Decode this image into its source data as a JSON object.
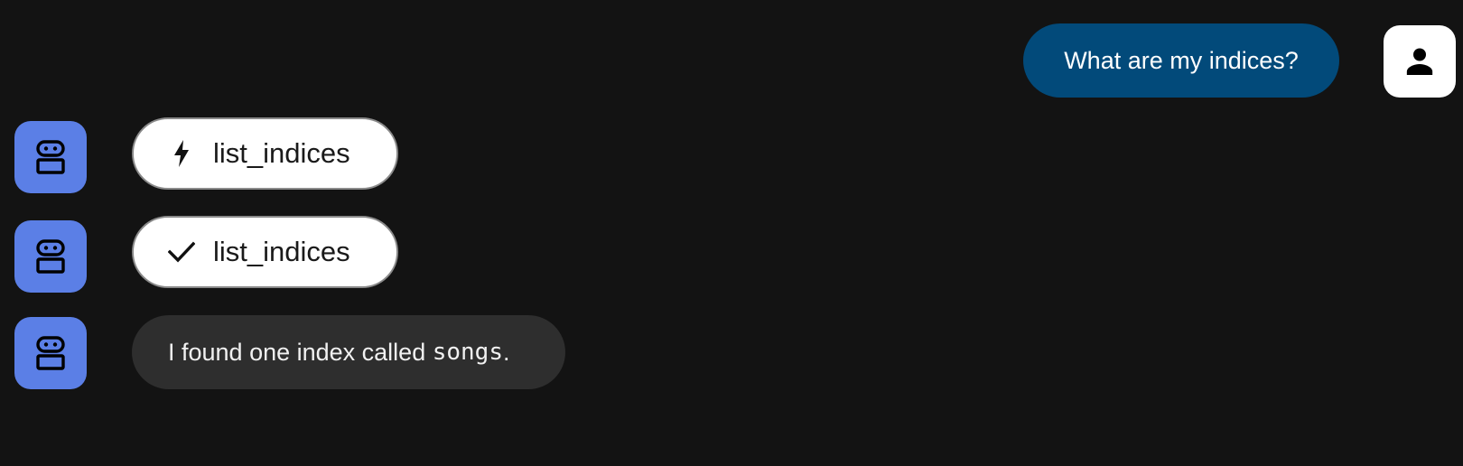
{
  "messages": {
    "user_query": "What are my indices?",
    "tool_call_running": "list_indices",
    "tool_call_done": "list_indices",
    "bot_reply_prefix": "I found one index called ",
    "bot_reply_code": "songs",
    "bot_reply_suffix": "."
  },
  "icons": {
    "user_avatar": "person-icon",
    "bot_avatar": "robot-icon",
    "running": "bolt-icon",
    "done": "check-icon"
  },
  "colors": {
    "background": "#131313",
    "user_bubble": "#024a7a",
    "bot_avatar": "#5b7fe6",
    "bot_bubble": "#2e2e2e",
    "chip": "#ffffff"
  }
}
